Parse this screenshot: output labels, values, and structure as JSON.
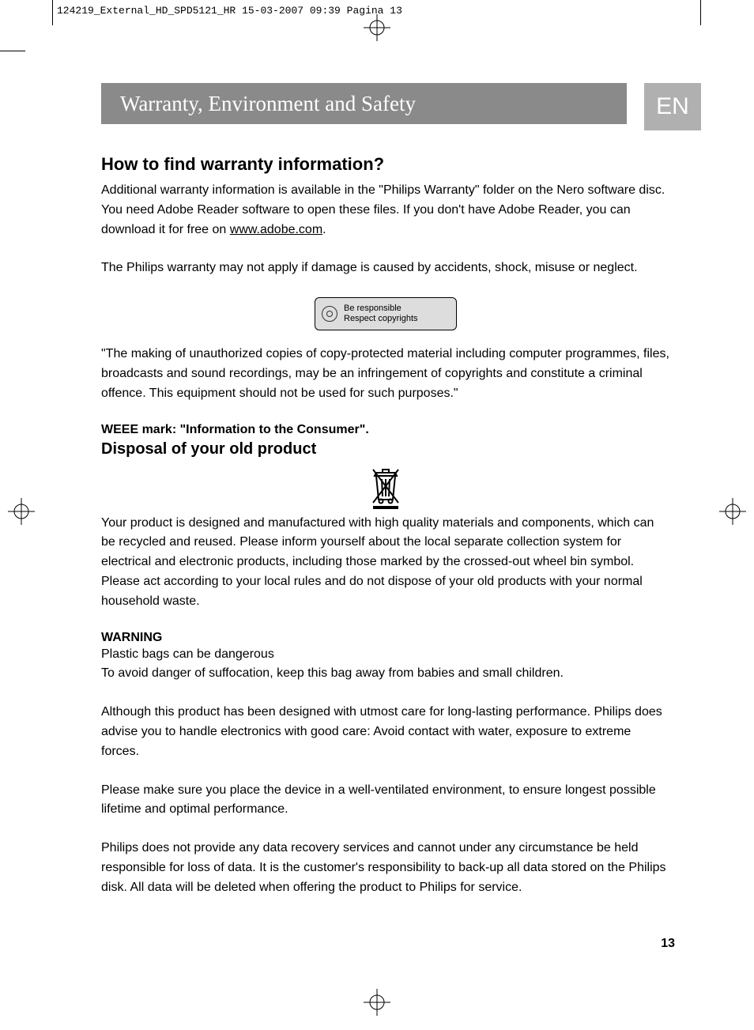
{
  "print_header": "124219_External_HD_SPD5121_HR  15-03-2007  09:39  Pagina 13",
  "title_bar": "Warranty, Environment and Safety",
  "lang": "EN",
  "page_num": "13",
  "copyright_box": {
    "line1": "Be responsible",
    "line2": "Respect copyrights"
  },
  "sections": {
    "warranty_h": "How to find warranty information?",
    "warranty_p1a": "Additional warranty information is available in the \"Philips Warranty\" folder on the Nero software disc.",
    "warranty_p1b_pre": "You need Adobe Reader software to open these files. If you don't have Adobe Reader, you can download it for free on ",
    "warranty_link": "www.adobe.com",
    "warranty_p1b_post": ".",
    "warranty_p2": "The Philips warranty may not apply if damage is caused by accidents, shock, misuse or neglect.",
    "copy_p": "\"The making of unauthorized copies of copy-protected material including computer programmes, files, broadcasts and sound recordings, may be an infringement of copyrights and constitute a criminal offence. This equipment should not be used for such purposes.\"",
    "weee_h3": "WEEE mark: \"Information to the Consumer\".",
    "weee_h2": "Disposal of your old product",
    "weee_p": "Your product is designed and manufactured with high quality materials and components, which can be recycled and reused. Please inform yourself about the local separate collection system for electrical and electronic products, including those marked by the crossed-out wheel bin symbol. Please act according to your local rules and do not dispose of your old products with your normal household waste.",
    "warning_h": "WARNING",
    "warning_l1": "Plastic bags can be dangerous",
    "warning_l2": "To avoid danger of suffocation, keep this bag away from babies and small children.",
    "care_p": "Although this product has been designed with utmost care for long-lasting performance. Philips does advise you to handle electronics with good care: Avoid contact with water, exposure to extreme forces.",
    "vent_p": "Please make sure you place the device in a well-ventilated environment, to ensure longest possible lifetime and optimal performance.",
    "data_p": "Philips does not provide any data recovery services and cannot under any circumstance be held responsible for loss of data. It is the customer's responsibility to back-up all data stored on the Philips disk. All data will be deleted when offering the product to Philips for service."
  }
}
